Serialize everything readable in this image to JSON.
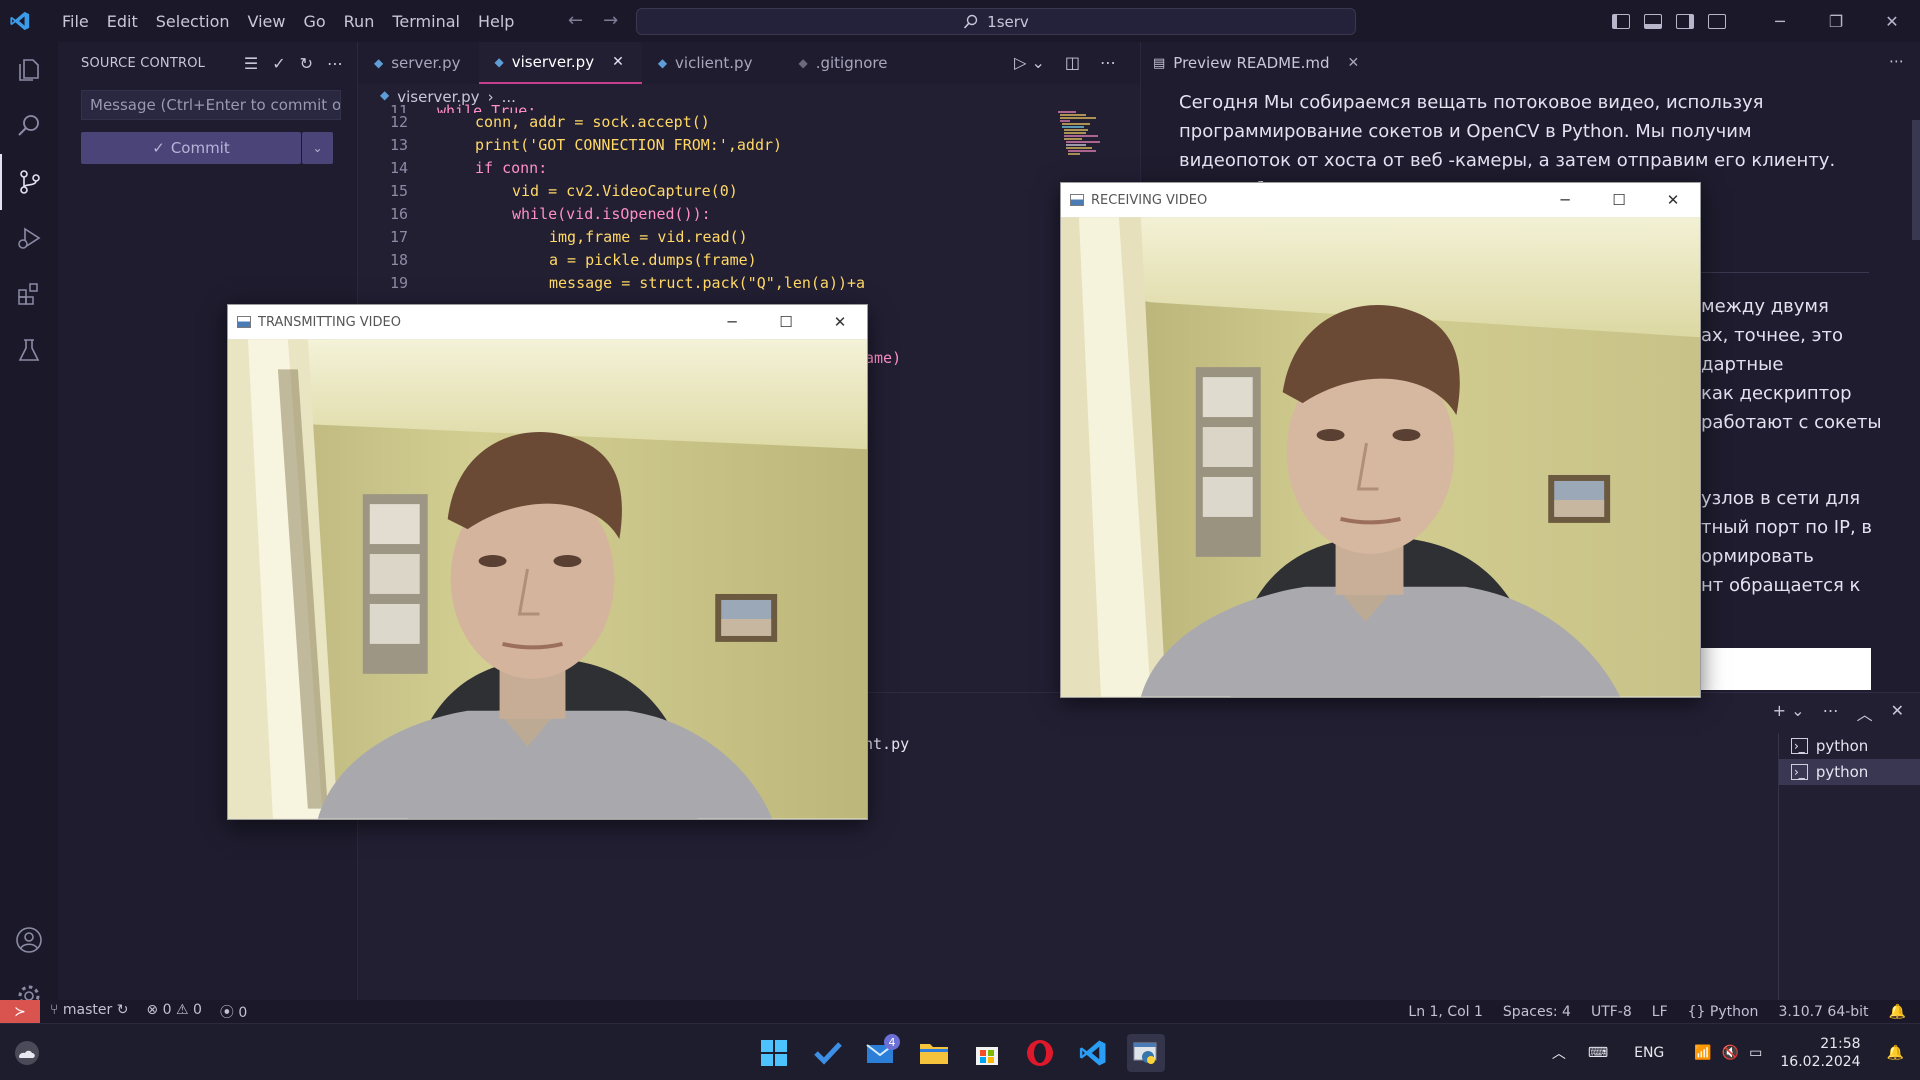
{
  "titlebar": {
    "menu": [
      "File",
      "Edit",
      "Selection",
      "View",
      "Go",
      "Run",
      "Terminal",
      "Help"
    ],
    "search": "1serv"
  },
  "sidebar": {
    "title": "SOURCE CONTROL",
    "commit_placeholder": "Message (Ctrl+Enter to commit o...",
    "commit_label": "Commit"
  },
  "editor": {
    "tabs": [
      {
        "label": "server.py",
        "active": false
      },
      {
        "label": "viserver.py",
        "active": true
      },
      {
        "label": "viclient.py",
        "active": false
      },
      {
        "label": ".gitignore",
        "active": false
      }
    ],
    "breadcrumb": [
      "viserver.py",
      "..."
    ],
    "lines": [
      {
        "num": "11",
        "code": "while True:"
      },
      {
        "num": "12",
        "code": "conn, addr = sock.accept()"
      },
      {
        "num": "13",
        "code": "print('GOT CONNECTION FROM:',addr)"
      },
      {
        "num": "14",
        "code": "if conn:"
      },
      {
        "num": "15",
        "code": "vid = cv2.VideoCapture(0)"
      },
      {
        "num": "16",
        "code": "while(vid.isOpened()):"
      },
      {
        "num": "17",
        "code": "img,frame = vid.read()"
      },
      {
        "num": "18",
        "code": "a = pickle.dumps(frame)"
      },
      {
        "num": "19",
        "code": "message = struct.pack(\"Q\",len(a))+a"
      }
    ],
    "partial_visible": "ame)"
  },
  "preview": {
    "tab_label": "Preview README.md",
    "paragraph1": "Сегодня Мы собираемся вещать потоковое видео, используя программирование сокетов и OpenCV в Python. Мы получим видеопоток от хоста от веб -камеры, а затем отправим его клиенту. Таким образом,",
    "fragments": [
      "между двумя",
      "ах, точнее, это",
      "дартные",
      "как дескриптор",
      "работают с сокеты",
      "узлов в сети для",
      "тный порт по IP, в",
      "ормировать",
      "нт обращается к"
    ]
  },
  "terminal": {
    "partial_text": "nt.py",
    "sessions": [
      "python",
      "python"
    ]
  },
  "statusbar": {
    "branch": "master",
    "errors": "0",
    "warnings": "0",
    "ports": "0",
    "position": "Ln 1, Col 1",
    "spaces": "Spaces: 4",
    "encoding": "UTF-8",
    "eol": "LF",
    "language": "Python",
    "interpreter": "3.10.7 64-bit"
  },
  "windows": {
    "transmit_title": "TRANSMITTING VIDEO",
    "receive_title": "RECEIVING VIDEO"
  },
  "taskbar": {
    "mail_badge": "4",
    "lang": "ENG",
    "time": "21:58",
    "date": "16.02.2024"
  },
  "colors": {
    "accent": "#c63f8f",
    "remote": "#d9534f",
    "commit_button": "#4a4479"
  }
}
